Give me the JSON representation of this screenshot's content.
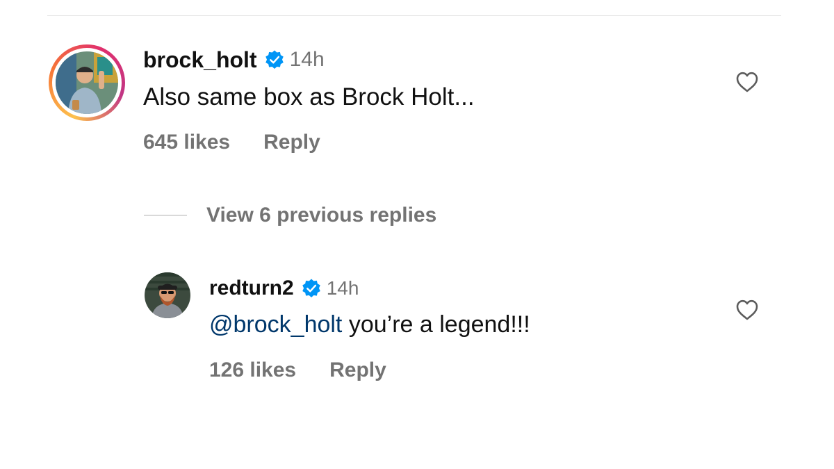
{
  "comments": [
    {
      "username": "brock_holt",
      "verified": true,
      "timestamp": "14h",
      "text": "Also same box as Brock Holt...",
      "likes": "645 likes",
      "reply_label": "Reply",
      "has_story_ring": true
    },
    {
      "username": "redturn2",
      "verified": true,
      "timestamp": "14h",
      "mention": "@brock_holt",
      "text": " you’re a legend!!!",
      "likes": "126 likes",
      "reply_label": "Reply",
      "has_story_ring": false
    }
  ],
  "view_replies": {
    "label": "View 6 previous replies"
  },
  "colors": {
    "text_primary": "#111111",
    "text_secondary": "#737373",
    "mention": "#00376b",
    "verified_badge": "#0095f6",
    "divider": "#e6e6e6"
  },
  "icons": {
    "verified": "verified-badge-icon",
    "like": "heart-outline-icon"
  }
}
